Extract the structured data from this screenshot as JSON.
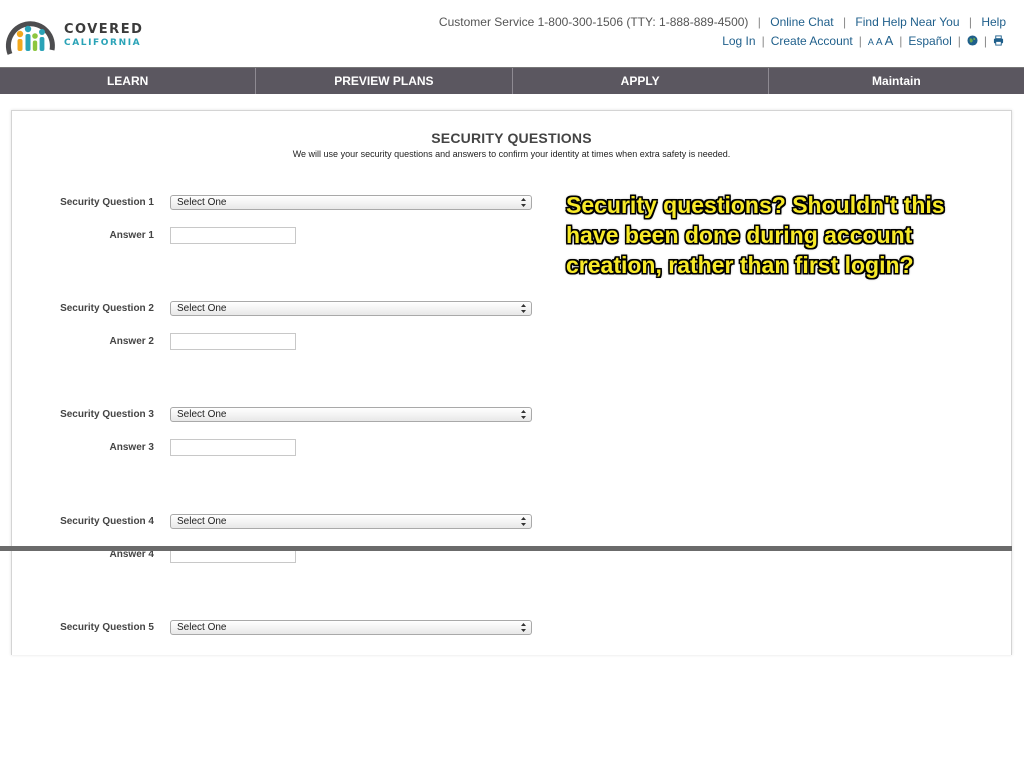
{
  "header": {
    "logo": {
      "word1": "COVERED",
      "word2": "CALIFORNIA"
    },
    "customer_service": "Customer Service 1-800-300-1506 (TTY: 1-888-889-4500)",
    "links_row1": [
      "Online Chat",
      "Find Help Near You",
      "Help"
    ],
    "links_row2": [
      "Log In",
      "Create Account"
    ],
    "text_size": [
      "A",
      "A",
      "A"
    ],
    "language": "Español",
    "icons": [
      "globe-icon",
      "print-icon"
    ]
  },
  "nav": {
    "items": [
      "LEARN",
      "PREVIEW PLANS",
      "APPLY",
      "Maintain"
    ]
  },
  "page": {
    "title": "SECURITY QUESTIONS",
    "subtitle": "We will use your security questions and answers to confirm your identity at times when extra safety is needed."
  },
  "questions": [
    {
      "label": "Security Question 1",
      "selected": "Select One",
      "answer_label": "Answer 1",
      "answer": ""
    },
    {
      "label": "Security Question 2",
      "selected": "Select One",
      "answer_label": "Answer 2",
      "answer": ""
    },
    {
      "label": "Security Question 3",
      "selected": "Select One",
      "answer_label": "Answer 3",
      "answer": ""
    },
    {
      "label": "Security Question 4",
      "selected": "Select One",
      "answer_label": "Answer 4",
      "answer": ""
    },
    {
      "label": "Security Question 5",
      "selected": "Select One"
    }
  ],
  "annotation": {
    "lines": [
      "Security questions? Shouldn't this",
      "have been done during account",
      "creation, rather than first login?"
    ],
    "color": "#f7e928"
  },
  "colors": {
    "nav_bg": "#5b5760",
    "link": "#1f5f8b",
    "brand_teal": "#2aa3b7"
  }
}
